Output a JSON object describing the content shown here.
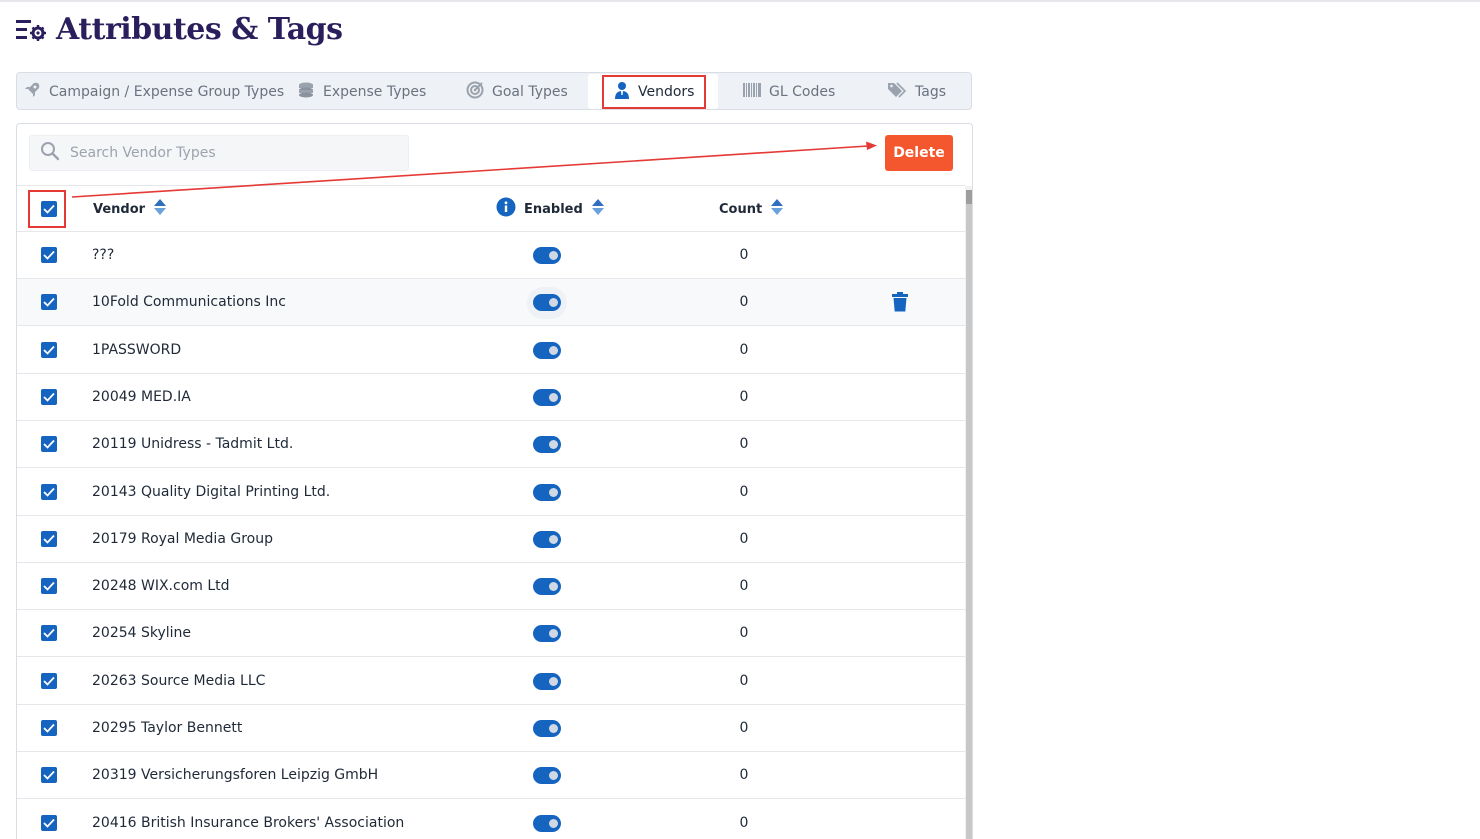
{
  "page": {
    "title": "Attributes & Tags"
  },
  "tabs": [
    {
      "label": "Campaign / Expense Group Types",
      "icon": "rocket-icon"
    },
    {
      "label": "Expense Types",
      "icon": "coins-icon"
    },
    {
      "label": "Goal Types",
      "icon": "target-icon"
    },
    {
      "label": "Vendors",
      "icon": "user-tie-icon",
      "active": true
    },
    {
      "label": "GL Codes",
      "icon": "barcode-icon"
    },
    {
      "label": "Tags",
      "icon": "tags-icon"
    }
  ],
  "search": {
    "placeholder": "Search Vendor Types"
  },
  "actions": {
    "delete_label": "Delete"
  },
  "table": {
    "headers": {
      "vendor": "Vendor",
      "enabled": "Enabled",
      "count": "Count"
    },
    "rows": [
      {
        "vendor": "???",
        "enabled": true,
        "count": "0"
      },
      {
        "vendor": "10Fold Communications Inc",
        "enabled": true,
        "count": "0"
      },
      {
        "vendor": "1PASSWORD",
        "enabled": true,
        "count": "0"
      },
      {
        "vendor": "20049 MED.IA",
        "enabled": true,
        "count": "0"
      },
      {
        "vendor": "20119 Unidress - Tadmit Ltd.",
        "enabled": true,
        "count": "0"
      },
      {
        "vendor": "20143 Quality Digital Printing Ltd.",
        "enabled": true,
        "count": "0"
      },
      {
        "vendor": "20179 Royal Media Group",
        "enabled": true,
        "count": "0"
      },
      {
        "vendor": "20248 WIX.com Ltd",
        "enabled": true,
        "count": "0"
      },
      {
        "vendor": "20254 Skyline",
        "enabled": true,
        "count": "0"
      },
      {
        "vendor": "20263 Source Media LLC",
        "enabled": true,
        "count": "0"
      },
      {
        "vendor": "20295 Taylor Bennett",
        "enabled": true,
        "count": "0"
      },
      {
        "vendor": "20319 Versicherungsforen Leipzig GmbH",
        "enabled": true,
        "count": "0"
      },
      {
        "vendor": "20416 British Insurance Brokers' Association",
        "enabled": true,
        "count": "0"
      }
    ]
  },
  "colors": {
    "accent": "#1565c0",
    "delete": "#f4572d",
    "highlight": "#e53935",
    "title": "#2b1e5c"
  }
}
